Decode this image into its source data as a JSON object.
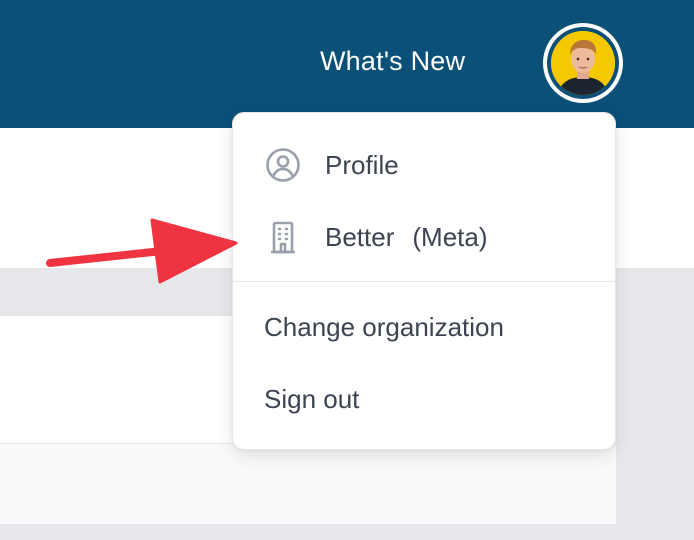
{
  "header": {
    "whats_new_label": "What's New"
  },
  "user_menu": {
    "items": [
      {
        "label": "Profile",
        "icon": "user-circle-icon"
      },
      {
        "label": "Better",
        "suffix": "(Meta)",
        "icon": "building-icon"
      }
    ],
    "actions": [
      {
        "label": "Change organization"
      },
      {
        "label": "Sign out"
      }
    ]
  },
  "colors": {
    "header_bg": "#0b5077",
    "avatar_bg": "#f5c800",
    "menu_text": "#3d4451",
    "icon_gray": "#9aa0ab",
    "annotation_arrow": "#ef3340"
  }
}
